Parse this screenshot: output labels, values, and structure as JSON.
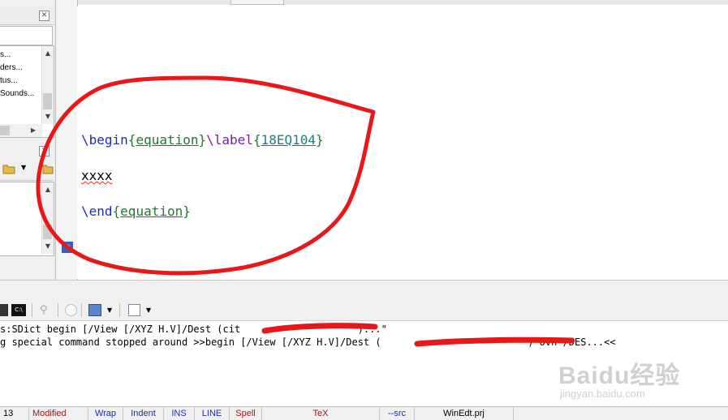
{
  "left_panel": {
    "tree_items": [
      "s...",
      "ders...",
      "tus...",
      "Sounds..."
    ]
  },
  "editor": {
    "lines": [
      {
        "cmd": "\\begin",
        "open": "{",
        "arg": "equation",
        "close": "}",
        "cmd2": "\\label",
        "open2": "{",
        "arg2": "18EQ104",
        "close2": "}"
      },
      {
        "text": "xxxx"
      },
      {
        "cmd": "\\end",
        "open": "{",
        "arg": "equation",
        "close": "}"
      }
    ]
  },
  "console": {
    "lines": [
      "s:SDict begin [/View [/XYZ H.V]/Dest (cit                    )...\"",
      "g special command stopped around >>begin [/View [/XYZ H.V]/Dest (                         ) ovn /DES...<<"
    ]
  },
  "status_bar": {
    "line_number": "13",
    "modified": "Modified",
    "wrap": "Wrap",
    "indent": "Indent",
    "ins": "INS",
    "line": "LINE",
    "spell": "Spell",
    "mode": "TeX",
    "src": "--src",
    "project": "WinEdt.prj"
  },
  "watermark": {
    "main": "Baidu经验",
    "sub": "jingyan.baidu.com"
  },
  "colors": {
    "annotation": "#e81818",
    "command": "#1e2bb8",
    "argument": "#1f7a2c",
    "label_arg": "#1c7f86",
    "label_cmd": "#7a1fa0"
  }
}
